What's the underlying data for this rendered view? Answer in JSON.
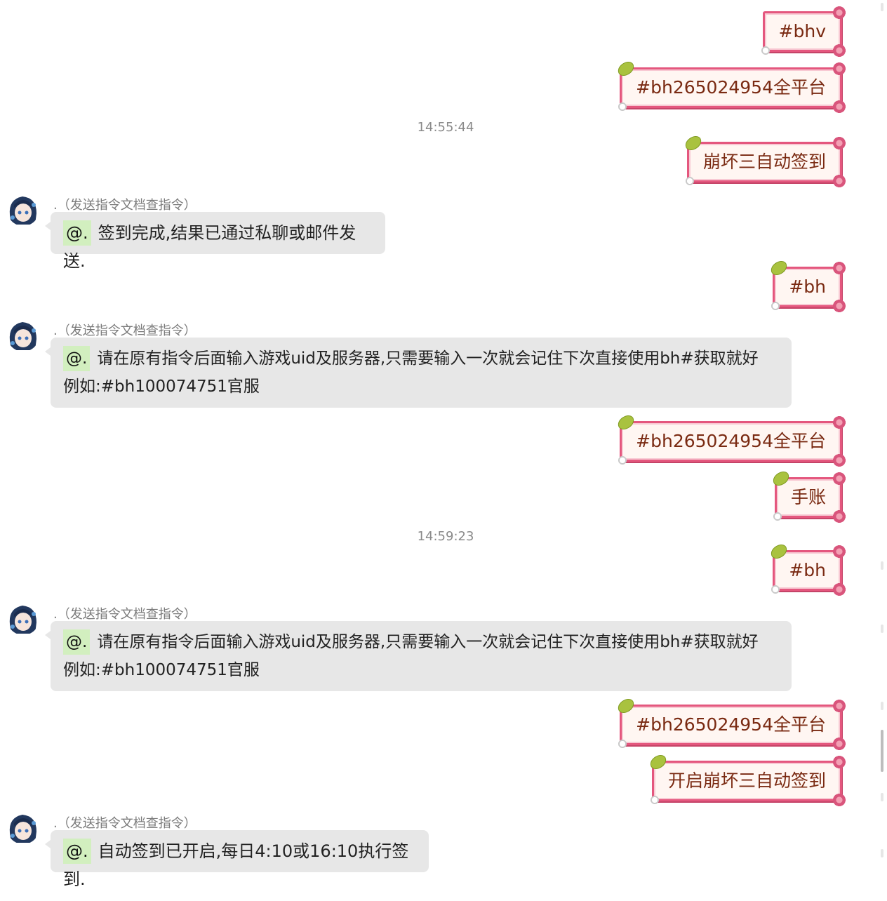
{
  "messages": {
    "out1": "#bhv",
    "out2": "#bh265024954全平台",
    "time1": "14:55:44",
    "out3": "崩坏三自动签到",
    "in1": {
      "sender": ".（发送指令文档查指令）",
      "at": "@.",
      "text": "签到完成,结果已通过私聊或邮件发送."
    },
    "out4": "#bh",
    "in2": {
      "sender": ".（发送指令文档查指令）",
      "at": "@.",
      "line1": "请在原有指令后面输入游戏uid及服务器,只需要输入一次就会记住下次直接使用bh#获取就好",
      "line2": "例如:#bh100074751官服"
    },
    "out5": "#bh265024954全平台",
    "out6": "手账",
    "time2": "14:59:23",
    "out7": "#bh",
    "in3": {
      "sender": ".（发送指令文档查指令）",
      "at": "@.",
      "line1": "请在原有指令后面输入游戏uid及服务器,只需要输入一次就会记住下次直接使用bh#获取就好",
      "line2": "例如:#bh100074751官服"
    },
    "out8": "#bh265024954全平台",
    "out9": "开启崩坏三自动签到",
    "in4": {
      "sender": ".（发送指令文档查指令）",
      "at": "@.",
      "text": "自动签到已开启,每日4:10或16:10执行签到."
    }
  },
  "colors": {
    "out_border": "#e4577e",
    "out_bg": "#fff6f2",
    "out_text": "#7a2a12",
    "in_bg": "#e7e7e7",
    "at_chip": "#d2efbf",
    "timestamp": "#8a8a8a"
  },
  "icons": {
    "avatar": "anime-character-avatar",
    "bubble_decor": "floral-frame"
  }
}
